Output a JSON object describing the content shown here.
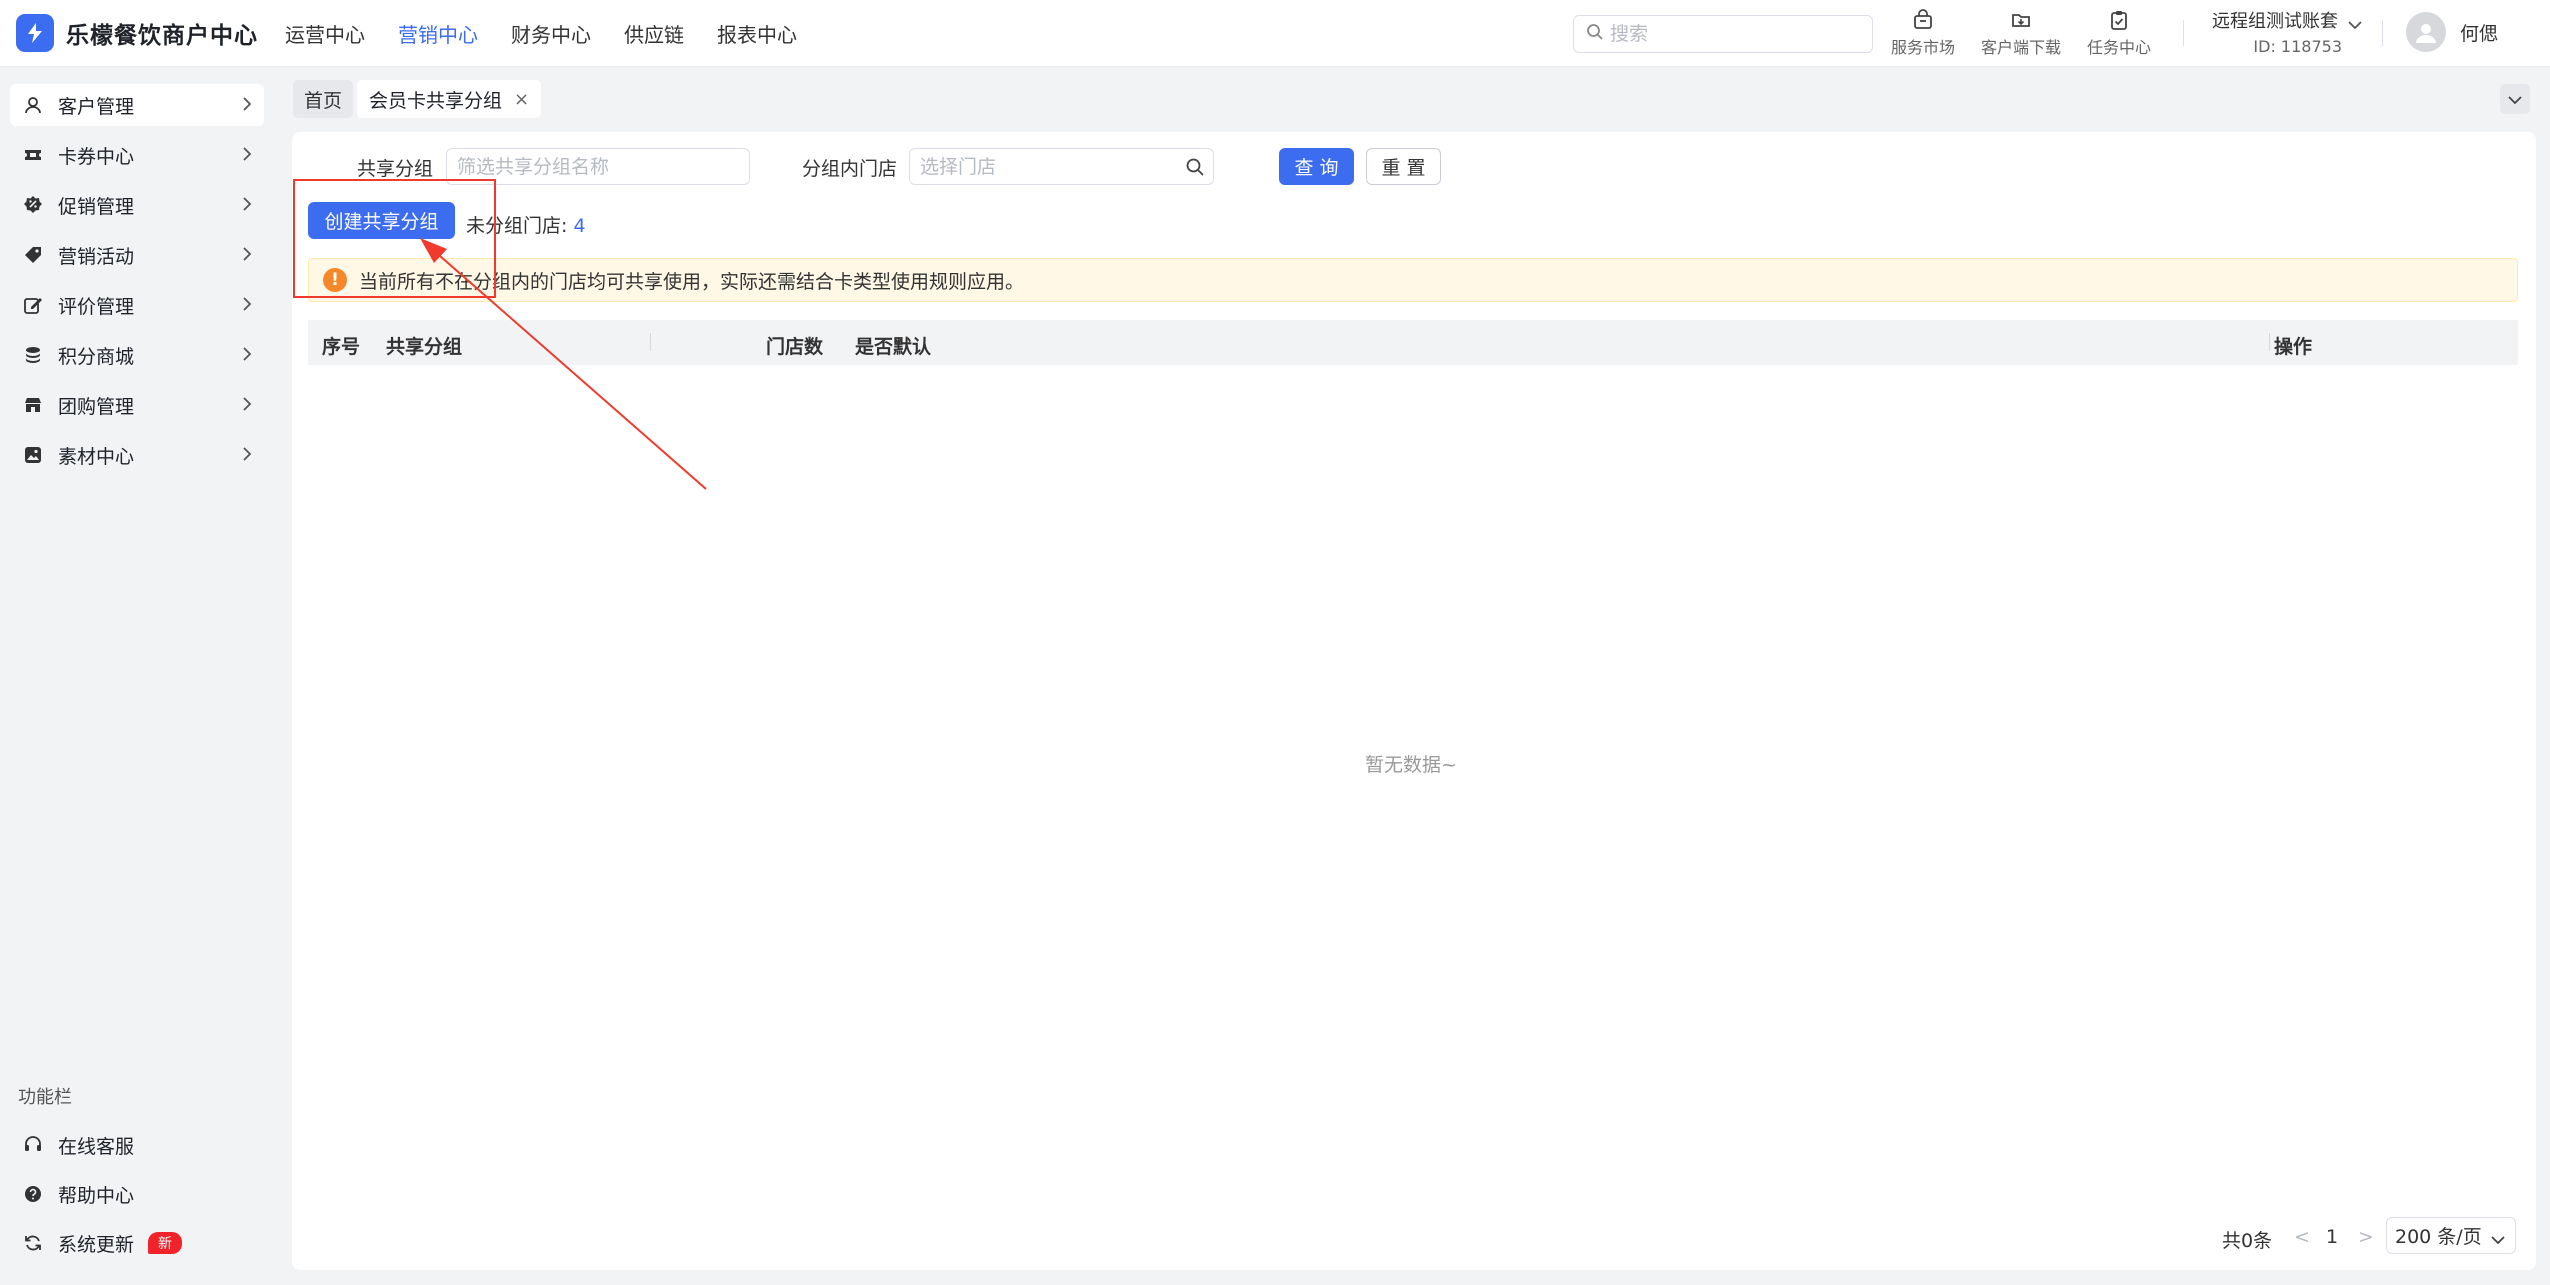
{
  "app": {
    "brand_name": "乐檬餐饮商户中心",
    "brand_color": "#3c6cf0",
    "logo_icon": "lightning-logo-icon"
  },
  "top_nav": {
    "items": [
      {
        "label": "运营中心"
      },
      {
        "label": "营销中心"
      },
      {
        "label": "财务中心"
      },
      {
        "label": "供应链"
      },
      {
        "label": "报表中心"
      }
    ],
    "active": "营销中心"
  },
  "search": {
    "placeholder": "搜索",
    "value": ""
  },
  "tools": [
    {
      "label": "服务市场",
      "icon": "store-bag-icon"
    },
    {
      "label": "客户端下载",
      "icon": "folder-download-icon"
    },
    {
      "label": "任务中心",
      "icon": "clipboard-check-icon"
    }
  ],
  "account": {
    "name": "远程组测试账套",
    "id": "ID: 118753"
  },
  "user": {
    "name": "何偲",
    "avatar_icon": "user-avatar-icon"
  },
  "sidebar": {
    "items": [
      {
        "label": "客户管理",
        "icon": "user-icon"
      },
      {
        "label": "卡券中心",
        "icon": "ticket-icon"
      },
      {
        "label": "促销管理",
        "icon": "discount-icon"
      },
      {
        "label": "营销活动",
        "icon": "tag-icon"
      },
      {
        "label": "评价管理",
        "icon": "edit-review-icon"
      },
      {
        "label": "积分商城",
        "icon": "coins-stack-icon"
      },
      {
        "label": "团购管理",
        "icon": "shop-icon"
      },
      {
        "label": "素材中心",
        "icon": "image-icon"
      }
    ],
    "active": "客户管理",
    "section_title": "功能栏",
    "bottom_items": [
      {
        "label": "在线客服",
        "icon": "headset-icon"
      },
      {
        "label": "帮助中心",
        "icon": "help-circle-icon"
      },
      {
        "label": "系统更新",
        "icon": "refresh-icon",
        "badge": "新"
      }
    ]
  },
  "tabs": {
    "home": "首页",
    "current": "会员卡共享分组",
    "close_symbol": "×"
  },
  "filters": {
    "group_label": "共享分组",
    "group_placeholder": "筛选共享分组名称",
    "store_label": "分组内门店",
    "store_placeholder": "选择门店",
    "query_button": "查 询",
    "reset_button": "重 置"
  },
  "actions": {
    "create_button": "创建共享分组",
    "unassigned_label": "未分组门店:",
    "unassigned_count": "4"
  },
  "notice": {
    "icon_text": "!",
    "text": "当前所有不在分组内的门店均可共享使用，实际还需结合卡类型使用规则应用。",
    "color": "#f5882a"
  },
  "table": {
    "columns": [
      "序号",
      "共享分组",
      "门店数",
      "是否默认",
      "操作"
    ],
    "rows": [],
    "empty_text": "暂无数据~"
  },
  "pagination": {
    "total": "共0条",
    "current_page": "1",
    "page_size": "200 条/页",
    "prev_symbol": "<",
    "next_symbol": ">"
  },
  "annotation": {
    "color": "#f03a2e"
  }
}
